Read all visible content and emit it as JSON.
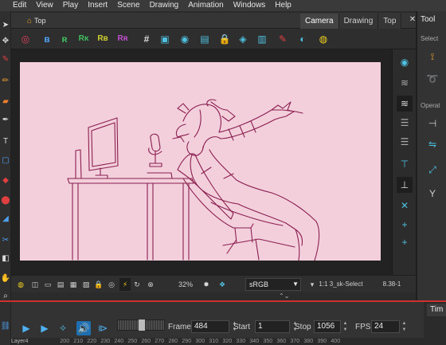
{
  "menu": [
    "Edit",
    "View",
    "Play",
    "Insert",
    "Scene",
    "Drawing",
    "Animation",
    "Windows",
    "Help"
  ],
  "view": {
    "breadcrumb": "Top",
    "tabs": [
      "Camera",
      "Drawing",
      "Top"
    ],
    "active_tab": "Camera"
  },
  "status": {
    "zoom": "32%",
    "color_space": "sRGB",
    "tool_info": "1:1  3_sk-Select",
    "coords": "8.38-1"
  },
  "playback": {
    "frame_label": "Frame",
    "frame_value": "484",
    "start_label": "Start",
    "start_value": "1",
    "stop_label": "Stop",
    "stop_value": "1056",
    "fps_label": "FPS",
    "fps_value": "24"
  },
  "ruler": {
    "layer_name": "Layer4",
    "ticks": [
      "200",
      "210",
      "220",
      "230",
      "240",
      "250",
      "260",
      "270",
      "280",
      "290",
      "300",
      "310",
      "320",
      "330",
      "340",
      "350",
      "360",
      "370",
      "380",
      "390",
      "400"
    ]
  },
  "tool_panel": {
    "title": "Tool",
    "select_label": "Select",
    "operations_label": "Operat"
  },
  "timeline_tab": "Tim",
  "colors": {
    "canvas_bg": "#f3cfdc",
    "line_art": "#8a1f4e",
    "accent": "#1f6fb0",
    "highlight_red": "#d03030"
  },
  "icons": {
    "toolbar": [
      "render-icon",
      "brush-b-icon",
      "brush-r-icon",
      "rk-icon",
      "rb-icon",
      "rr-icon",
      "grid-icon",
      "camera-icon",
      "onion-icon",
      "light-table-icon",
      "lock-icon",
      "eye-icon",
      "brush-color-icon",
      "lightbulb-icon"
    ]
  }
}
